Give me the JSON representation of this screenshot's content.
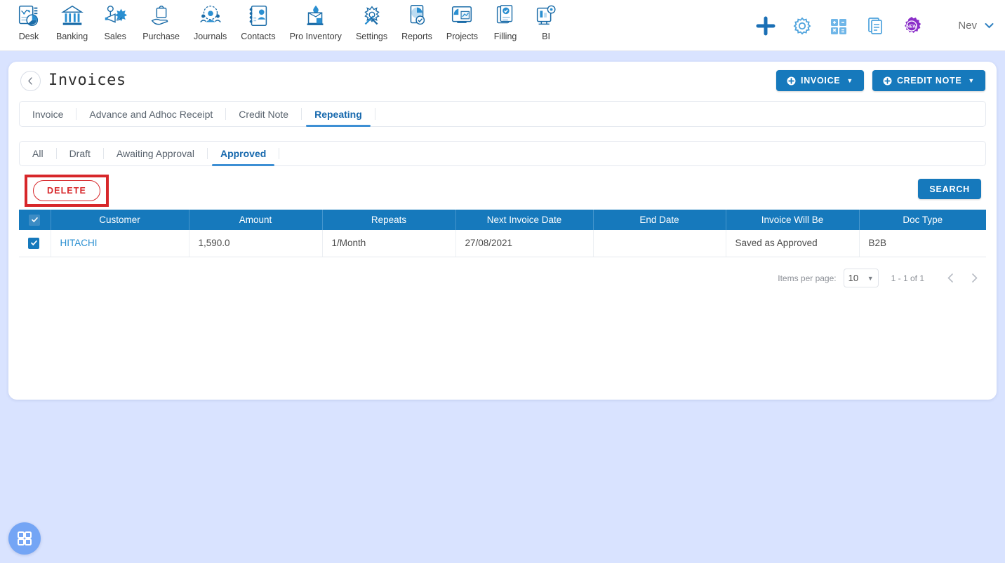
{
  "topnav": {
    "items": [
      {
        "label": "Desk",
        "icon": "desk-dashboard-icon"
      },
      {
        "label": "Banking",
        "icon": "bank-building-icon"
      },
      {
        "label": "Sales",
        "icon": "sales-megaphone-icon"
      },
      {
        "label": "Purchase",
        "icon": "purchase-hand-bag-icon"
      },
      {
        "label": "Journals",
        "icon": "journals-people-gear-icon"
      },
      {
        "label": "Contacts",
        "icon": "contacts-address-book-icon"
      },
      {
        "label": "Pro Inventory",
        "icon": "inventory-box-icon"
      },
      {
        "label": "Settings",
        "icon": "settings-tools-icon"
      },
      {
        "label": "Reports",
        "icon": "reports-pie-doc-icon"
      },
      {
        "label": "Projects",
        "icon": "projects-board-icon"
      },
      {
        "label": "Filling",
        "icon": "filling-docs-check-icon"
      },
      {
        "label": "BI",
        "icon": "bi-monitor-gear-icon"
      }
    ],
    "actions": [
      {
        "name": "add-plus-icon"
      },
      {
        "name": "gear-icon"
      },
      {
        "name": "calculator-icon"
      },
      {
        "name": "document-icon"
      },
      {
        "name": "new-badge-icon"
      }
    ],
    "user": {
      "name": "Nev",
      "chevron": "chevron-down-icon"
    }
  },
  "header": {
    "back": "back-chevron-icon",
    "title": "Invoices",
    "invoice_button": "INVOICE",
    "credit_note_button": "CREDIT NOTE"
  },
  "primary_tabs": [
    {
      "label": "Invoice",
      "active": false
    },
    {
      "label": "Advance and Adhoc Receipt",
      "active": false
    },
    {
      "label": "Credit Note",
      "active": false
    },
    {
      "label": "Repeating",
      "active": true
    }
  ],
  "status_tabs": [
    {
      "label": "All",
      "active": false
    },
    {
      "label": "Draft",
      "active": false
    },
    {
      "label": "Awaiting Approval",
      "active": false
    },
    {
      "label": "Approved",
      "active": true
    }
  ],
  "actionbar": {
    "delete_label": "DELETE",
    "search_label": "SEARCH",
    "highlight_color": "#d7272a"
  },
  "table": {
    "columns": [
      "Customer",
      "Amount",
      "Repeats",
      "Next Invoice Date",
      "End Date",
      "Invoice Will Be",
      "Doc Type"
    ],
    "header_checkbox_checked": true,
    "rows": [
      {
        "checked": true,
        "customer": "HITACHI",
        "amount": "1,590.0",
        "repeats": "1/Month",
        "next_invoice_date": "27/08/2021",
        "end_date": "",
        "invoice_will_be": "Saved as Approved",
        "doc_type": "B2B"
      }
    ]
  },
  "paginator": {
    "items_per_page_label": "Items per page:",
    "items_per_page_value": "10",
    "range": "1 - 1 of 1",
    "prev_icon": "chevron-left-icon",
    "next_icon": "chevron-right-icon"
  },
  "fab": {
    "icon": "grid-apps-icon"
  },
  "colors": {
    "accent": "#1679bc",
    "page_bg": "#d9e3ff",
    "danger": "#d7272a",
    "link": "#2a8fd1"
  }
}
